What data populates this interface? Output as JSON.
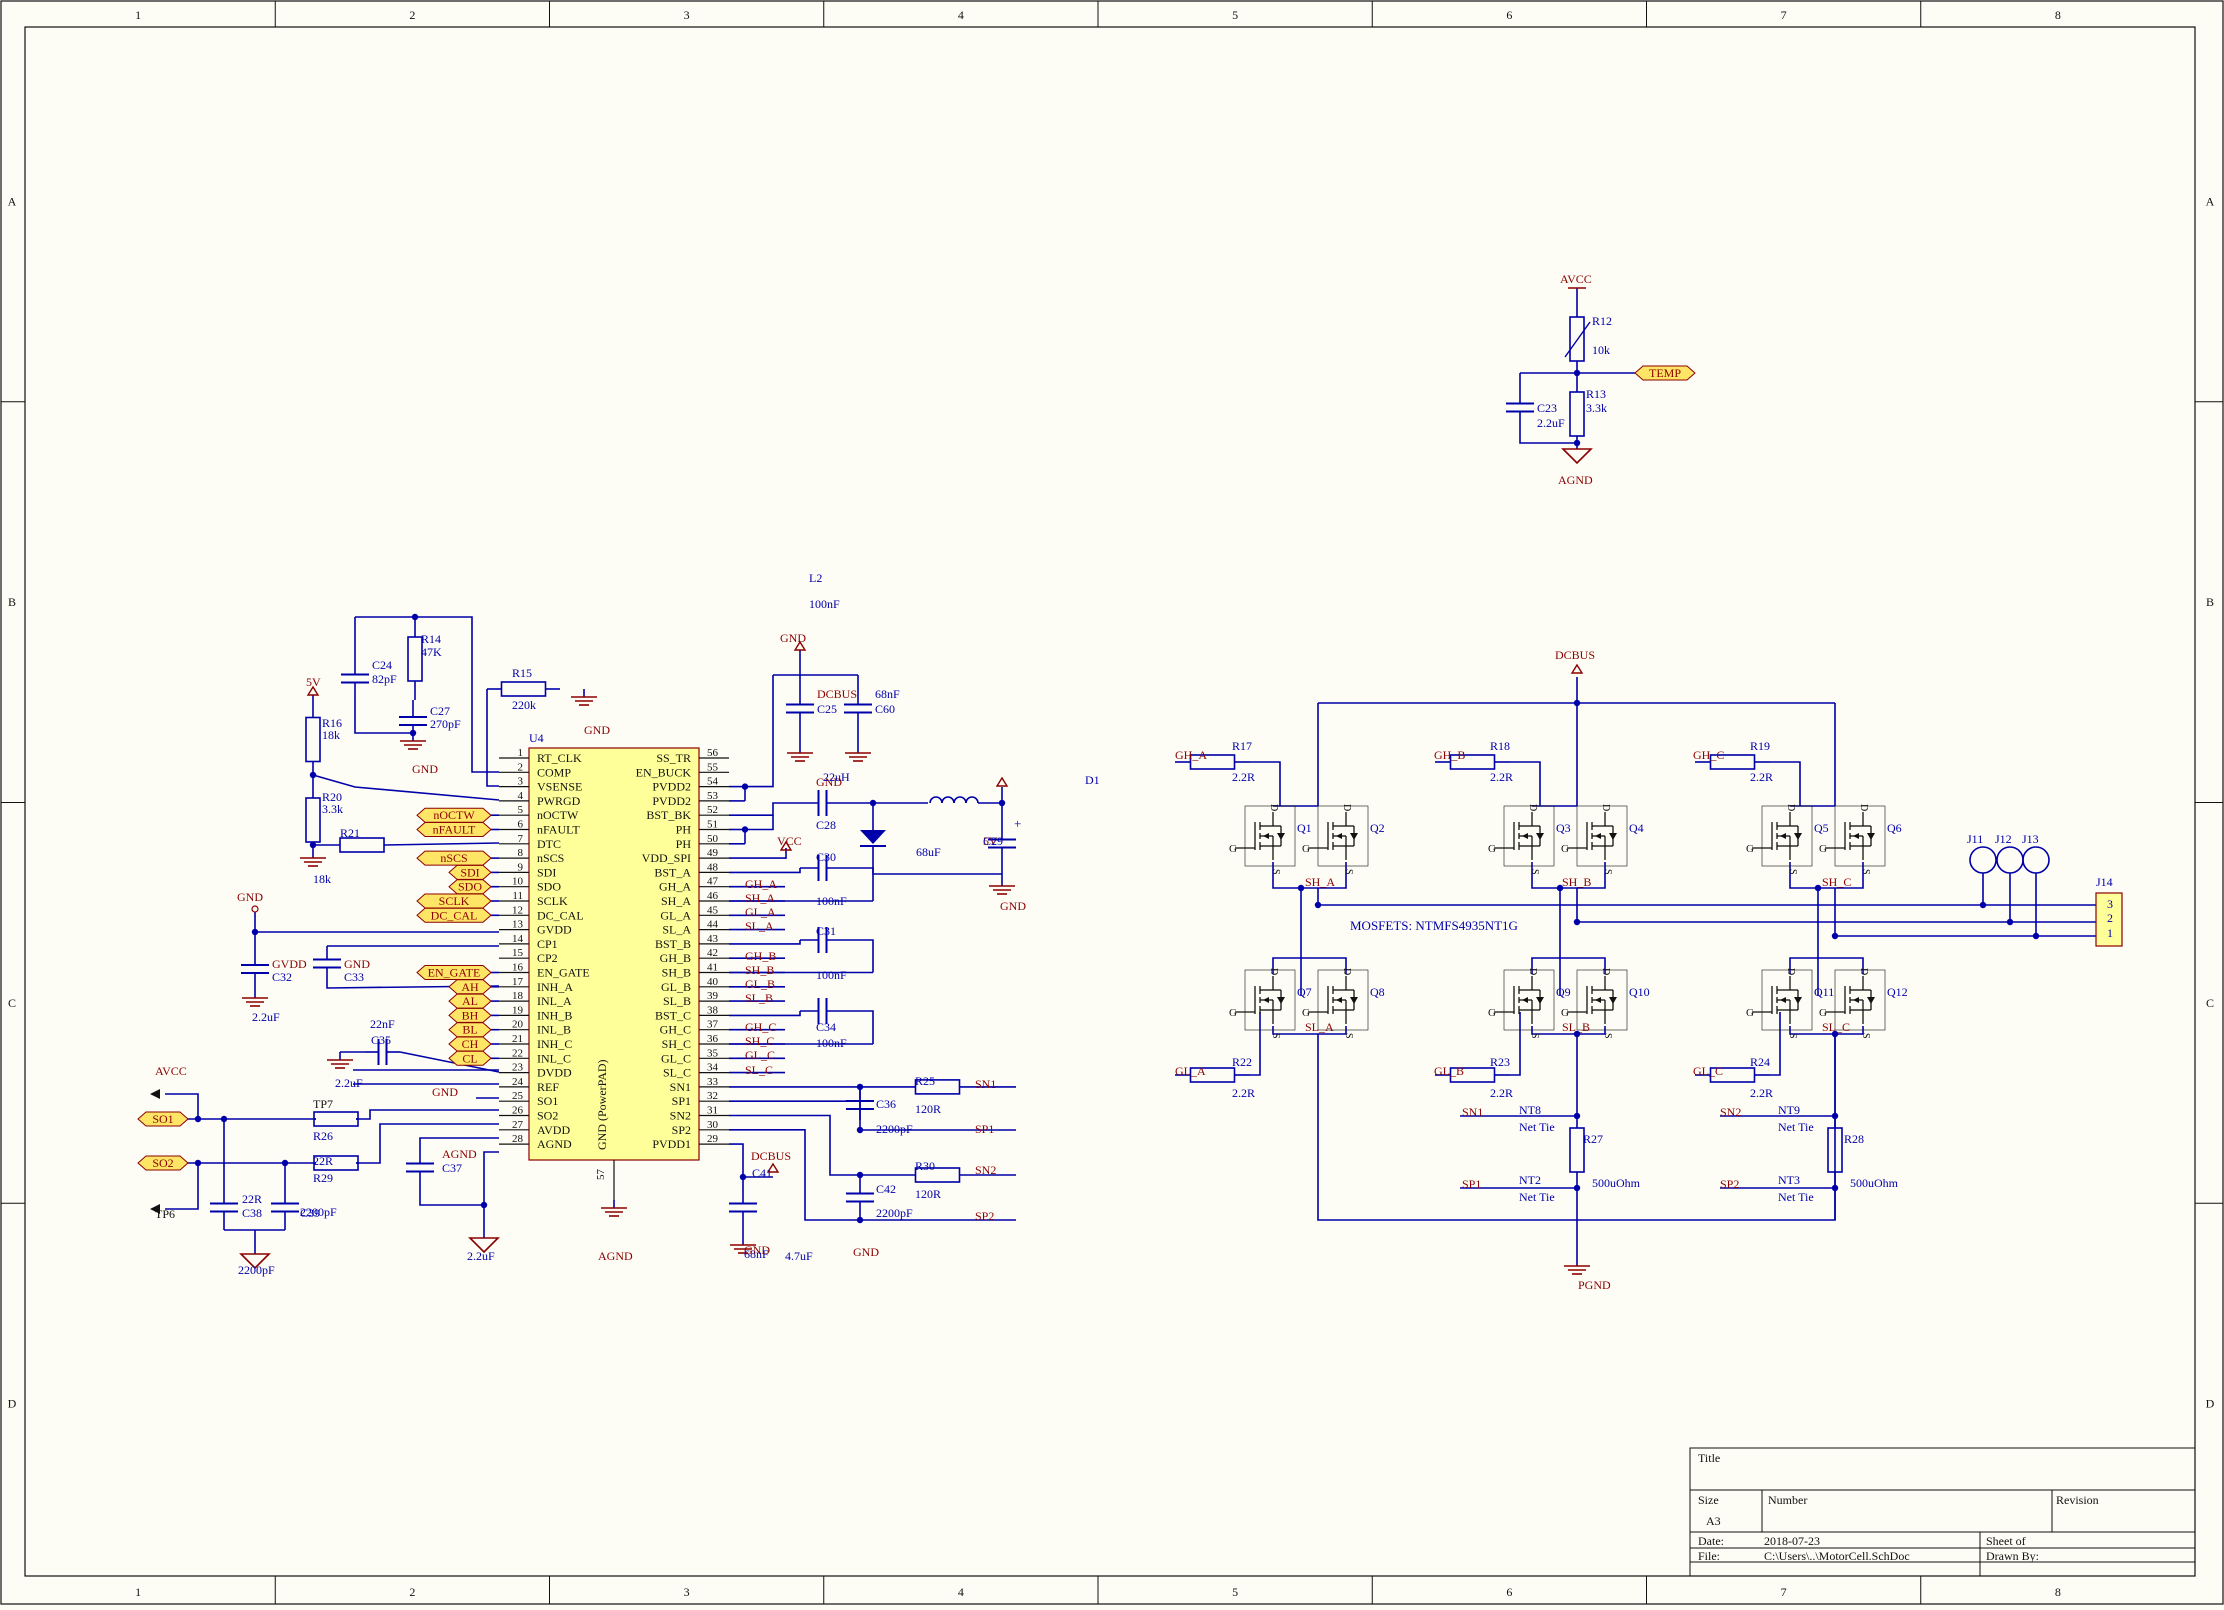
{
  "sheet": {
    "colors": {
      "background": "#fdfcf5",
      "border": "#111111",
      "wire": "#0000aa",
      "text_blue": "#0000aa",
      "net_red": "#8b0000",
      "ic_fill": "#ffff99",
      "ic_stroke": "#8b0000",
      "port_fill": "#ffe566"
    },
    "column_labels": [
      "1",
      "2",
      "3",
      "4",
      "5",
      "6",
      "7",
      "8"
    ],
    "row_labels": [
      "A",
      "B",
      "C",
      "D"
    ]
  },
  "title_block": {
    "title_label": "Title",
    "size_label": "Size",
    "size_value": "A3",
    "number_label": "Number",
    "revision_label": "Revision",
    "date_label": "Date:",
    "date_value": "2018-07-23",
    "sheet_label": "Sheet    of",
    "file_label": "File:",
    "file_value": "C:\\Users\\..\\MotorCell.SchDoc",
    "drawn_label": "Drawn By:"
  },
  "ic": {
    "designator": "U4",
    "center_label": "GND (PowerPAD)",
    "bottom_pin": "57",
    "left_pins": [
      {
        "n": "1",
        "name": "RT_CLK"
      },
      {
        "n": "2",
        "name": "COMP"
      },
      {
        "n": "3",
        "name": "VSENSE"
      },
      {
        "n": "4",
        "name": "PWRGD"
      },
      {
        "n": "5",
        "name": "nOCTW"
      },
      {
        "n": "6",
        "name": "nFAULT"
      },
      {
        "n": "7",
        "name": "DTC"
      },
      {
        "n": "8",
        "name": "nSCS"
      },
      {
        "n": "9",
        "name": "SDI"
      },
      {
        "n": "10",
        "name": "SDO"
      },
      {
        "n": "11",
        "name": "SCLK"
      },
      {
        "n": "12",
        "name": "DC_CAL"
      },
      {
        "n": "13",
        "name": "GVDD"
      },
      {
        "n": "14",
        "name": "CP1"
      },
      {
        "n": "15",
        "name": "CP2"
      },
      {
        "n": "16",
        "name": "EN_GATE"
      },
      {
        "n": "17",
        "name": "INH_A"
      },
      {
        "n": "18",
        "name": "INL_A"
      },
      {
        "n": "19",
        "name": "INH_B"
      },
      {
        "n": "20",
        "name": "INL_B"
      },
      {
        "n": "21",
        "name": "INH_C"
      },
      {
        "n": "22",
        "name": "INL_C"
      },
      {
        "n": "23",
        "name": "DVDD"
      },
      {
        "n": "24",
        "name": "REF"
      },
      {
        "n": "25",
        "name": "SO1"
      },
      {
        "n": "26",
        "name": "SO2"
      },
      {
        "n": "27",
        "name": "AVDD"
      },
      {
        "n": "28",
        "name": "AGND"
      }
    ],
    "right_pins": [
      {
        "n": "56",
        "name": "SS_TR"
      },
      {
        "n": "55",
        "name": "EN_BUCK"
      },
      {
        "n": "54",
        "name": "PVDD2"
      },
      {
        "n": "53",
        "name": "PVDD2"
      },
      {
        "n": "52",
        "name": "BST_BK"
      },
      {
        "n": "51",
        "name": "PH"
      },
      {
        "n": "50",
        "name": "PH"
      },
      {
        "n": "49",
        "name": "VDD_SPI"
      },
      {
        "n": "48",
        "name": "BST_A"
      },
      {
        "n": "47",
        "name": "GH_A"
      },
      {
        "n": "46",
        "name": "SH_A"
      },
      {
        "n": "45",
        "name": "GL_A"
      },
      {
        "n": "44",
        "name": "SL_A"
      },
      {
        "n": "43",
        "name": "BST_B"
      },
      {
        "n": "42",
        "name": "GH_B"
      },
      {
        "n": "41",
        "name": "SH_B"
      },
      {
        "n": "40",
        "name": "GL_B"
      },
      {
        "n": "39",
        "name": "SL_B"
      },
      {
        "n": "38",
        "name": "BST_C"
      },
      {
        "n": "37",
        "name": "GH_C"
      },
      {
        "n": "36",
        "name": "SH_C"
      },
      {
        "n": "35",
        "name": "GL_C"
      },
      {
        "n": "34",
        "name": "SL_C"
      },
      {
        "n": "33",
        "name": "SN1"
      },
      {
        "n": "32",
        "name": "SP1"
      },
      {
        "n": "31",
        "name": "SN2"
      },
      {
        "n": "30",
        "name": "SP2"
      },
      {
        "n": "29",
        "name": "PVDD1"
      }
    ]
  },
  "labels": [
    {
      "t": "R14",
      "c": "blue"
    },
    {
      "t": "47K",
      "c": "blue"
    },
    {
      "t": "C24",
      "c": "blue"
    },
    {
      "t": "82pF",
      "c": "blue"
    },
    {
      "t": "C27",
      "c": "blue"
    },
    {
      "t": "270pF",
      "c": "blue"
    },
    {
      "t": "GND",
      "c": "red"
    },
    {
      "t": "R15",
      "c": "blue"
    },
    {
      "t": "220k",
      "c": "blue"
    },
    {
      "t": "GND",
      "c": "red"
    },
    {
      "t": "5V",
      "c": "red"
    },
    {
      "t": "R16",
      "c": "blue"
    },
    {
      "t": "18k",
      "c": "blue"
    },
    {
      "t": "R20",
      "c": "blue"
    },
    {
      "t": "3.3k",
      "c": "blue"
    },
    {
      "t": "R21",
      "c": "blue"
    },
    {
      "t": "18k",
      "c": "blue"
    },
    {
      "t": "GND",
      "c": "red"
    },
    {
      "t": "GVDD",
      "c": "red"
    },
    {
      "t": "C32",
      "c": "blue"
    },
    {
      "t": "2.2uF",
      "c": "blue"
    },
    {
      "t": "GND",
      "c": "red"
    },
    {
      "t": "C33",
      "c": "blue"
    },
    {
      "t": "22nF",
      "c": "blue"
    },
    {
      "t": "C35",
      "c": "blue"
    },
    {
      "t": "2.2uF",
      "c": "blue"
    },
    {
      "t": "GND",
      "c": "red"
    },
    {
      "t": "AVCC",
      "c": "red"
    },
    {
      "t": "TP6",
      "c": "black"
    },
    {
      "t": "TP7",
      "c": "black"
    },
    {
      "t": "R26",
      "c": "blue"
    },
    {
      "t": "22R",
      "c": "blue"
    },
    {
      "t": "R29",
      "c": "blue"
    },
    {
      "t": "22R",
      "c": "blue"
    },
    {
      "t": "C38",
      "c": "blue"
    },
    {
      "t": "2200pF",
      "c": "blue"
    },
    {
      "t": "C39",
      "c": "blue"
    },
    {
      "t": "2200pF",
      "c": "blue"
    },
    {
      "t": "AGND",
      "c": "red"
    },
    {
      "t": "C37",
      "c": "blue"
    },
    {
      "t": "2.2uF",
      "c": "blue"
    },
    {
      "t": "AGND",
      "c": "red"
    },
    {
      "t": "GND",
      "c": "red"
    },
    {
      "t": "DCBUS",
      "c": "red"
    },
    {
      "t": "C25",
      "c": "blue"
    },
    {
      "t": "68nF",
      "c": "blue"
    },
    {
      "t": "C60",
      "c": "blue"
    },
    {
      "t": "4.7uF",
      "c": "blue"
    },
    {
      "t": "GND",
      "c": "red"
    },
    {
      "t": "GND",
      "c": "red"
    },
    {
      "t": "C28",
      "c": "blue"
    },
    {
      "t": "100nF",
      "c": "blue"
    },
    {
      "t": "L2",
      "c": "blue"
    },
    {
      "t": "22uH",
      "c": "blue"
    },
    {
      "t": "5V",
      "c": "red"
    },
    {
      "t": "C29",
      "c": "blue"
    },
    {
      "t": "68uF",
      "c": "blue"
    },
    {
      "t": "D1",
      "c": "blue"
    },
    {
      "t": "GND",
      "c": "red"
    },
    {
      "t": "VCC",
      "c": "red"
    },
    {
      "t": "C30",
      "c": "blue"
    },
    {
      "t": "100nF",
      "c": "blue"
    },
    {
      "t": "C31",
      "c": "blue"
    },
    {
      "t": "100nF",
      "c": "blue"
    },
    {
      "t": "C34",
      "c": "blue"
    },
    {
      "t": "100nF",
      "c": "blue"
    },
    {
      "t": "GH_A",
      "c": "red"
    },
    {
      "t": "SH_A",
      "c": "red"
    },
    {
      "t": "GL_A",
      "c": "red"
    },
    {
      "t": "SL_A",
      "c": "red"
    },
    {
      "t": "GH_B",
      "c": "red"
    },
    {
      "t": "SH_B",
      "c": "red"
    },
    {
      "t": "GL_B",
      "c": "red"
    },
    {
      "t": "SL_B",
      "c": "red"
    },
    {
      "t": "GH_C",
      "c": "red"
    },
    {
      "t": "SH_C",
      "c": "red"
    },
    {
      "t": "GL_C",
      "c": "red"
    },
    {
      "t": "SL_C",
      "c": "red"
    },
    {
      "t": "R25",
      "c": "blue"
    },
    {
      "t": "120R",
      "c": "blue"
    },
    {
      "t": "SN1",
      "c": "red"
    },
    {
      "t": "C36",
      "c": "blue"
    },
    {
      "t": "2200pF",
      "c": "blue"
    },
    {
      "t": "SP1",
      "c": "red"
    },
    {
      "t": "R30",
      "c": "blue"
    },
    {
      "t": "120R",
      "c": "blue"
    },
    {
      "t": "SN2",
      "c": "red"
    },
    {
      "t": "C42",
      "c": "blue"
    },
    {
      "t": "2200pF",
      "c": "blue"
    },
    {
      "t": "SP2",
      "c": "red"
    },
    {
      "t": "DCBUS",
      "c": "red"
    },
    {
      "t": "C41",
      "c": "blue"
    },
    {
      "t": "68nF",
      "c": "blue"
    },
    {
      "t": "GND",
      "c": "red"
    },
    {
      "t": "AVCC",
      "c": "red"
    },
    {
      "t": "R12",
      "c": "blue"
    },
    {
      "t": "10k",
      "c": "blue"
    },
    {
      "t": "R13",
      "c": "blue"
    },
    {
      "t": "3.3k",
      "c": "blue"
    },
    {
      "t": "C23",
      "c": "blue"
    },
    {
      "t": "2.2uF",
      "c": "blue"
    },
    {
      "t": "AGND",
      "c": "red"
    },
    {
      "t": "DCBUS",
      "c": "red"
    },
    {
      "t": "GH_A",
      "c": "red"
    },
    {
      "t": "R17",
      "c": "blue"
    },
    {
      "t": "2.2R",
      "c": "blue"
    },
    {
      "t": "GH_B",
      "c": "red"
    },
    {
      "t": "R18",
      "c": "blue"
    },
    {
      "t": "2.2R",
      "c": "blue"
    },
    {
      "t": "GH_C",
      "c": "red"
    },
    {
      "t": "R19",
      "c": "blue"
    },
    {
      "t": "2.2R",
      "c": "blue"
    },
    {
      "t": "SH_A",
      "c": "red"
    },
    {
      "t": "SH_B",
      "c": "red"
    },
    {
      "t": "SH_C",
      "c": "red"
    },
    {
      "t": "MOSFETS: NTMFS4935NT1G",
      "c": "blue"
    },
    {
      "t": "SL_A",
      "c": "red"
    },
    {
      "t": "SL_B",
      "c": "red"
    },
    {
      "t": "SL_C",
      "c": "red"
    },
    {
      "t": "GL_A",
      "c": "red"
    },
    {
      "t": "R22",
      "c": "blue"
    },
    {
      "t": "2.2R",
      "c": "blue"
    },
    {
      "t": "GL_B",
      "c": "red"
    },
    {
      "t": "R23",
      "c": "blue"
    },
    {
      "t": "2.2R",
      "c": "blue"
    },
    {
      "t": "GL_C",
      "c": "red"
    },
    {
      "t": "R24",
      "c": "blue"
    },
    {
      "t": "2.2R",
      "c": "blue"
    },
    {
      "t": "SN1",
      "c": "red"
    },
    {
      "t": "NT8",
      "c": "blue"
    },
    {
      "t": "Net Tie",
      "c": "blue"
    },
    {
      "t": "SP1",
      "c": "red"
    },
    {
      "t": "NT2",
      "c": "blue"
    },
    {
      "t": "Net Tie",
      "c": "blue"
    },
    {
      "t": "R27",
      "c": "blue"
    },
    {
      "t": "500uOhm",
      "c": "blue"
    },
    {
      "t": "SN2",
      "c": "red"
    },
    {
      "t": "NT9",
      "c": "blue"
    },
    {
      "t": "Net Tie",
      "c": "blue"
    },
    {
      "t": "SP2",
      "c": "red"
    },
    {
      "t": "NT3",
      "c": "blue"
    },
    {
      "t": "Net Tie",
      "c": "blue"
    },
    {
      "t": "R28",
      "c": "blue"
    },
    {
      "t": "500uOhm",
      "c": "blue"
    },
    {
      "t": "PGND",
      "c": "red"
    },
    {
      "t": "J11",
      "c": "blue"
    },
    {
      "t": "J12",
      "c": "blue"
    },
    {
      "t": "J13",
      "c": "blue"
    },
    {
      "t": "J14",
      "c": "blue"
    },
    {
      "t": "3",
      "c": "blue"
    },
    {
      "t": "2",
      "c": "blue"
    },
    {
      "t": "1",
      "c": "blue"
    }
  ],
  "ports": [
    "nOCTW",
    "nFAULT",
    "nSCS",
    "SDI",
    "SDO",
    "SCLK",
    "DC_CAL",
    "EN_GATE",
    "AH",
    "AL",
    "BH",
    "BL",
    "CH",
    "CL",
    "SO1",
    "SO2",
    "TEMP"
  ],
  "mosfets": [
    "Q1",
    "Q2",
    "Q3",
    "Q4",
    "Q5",
    "Q6",
    "Q7",
    "Q8",
    "Q9",
    "Q10",
    "Q11",
    "Q12"
  ],
  "mosfet_pins": {
    "gate": "G",
    "drain": "D",
    "source": "S"
  }
}
